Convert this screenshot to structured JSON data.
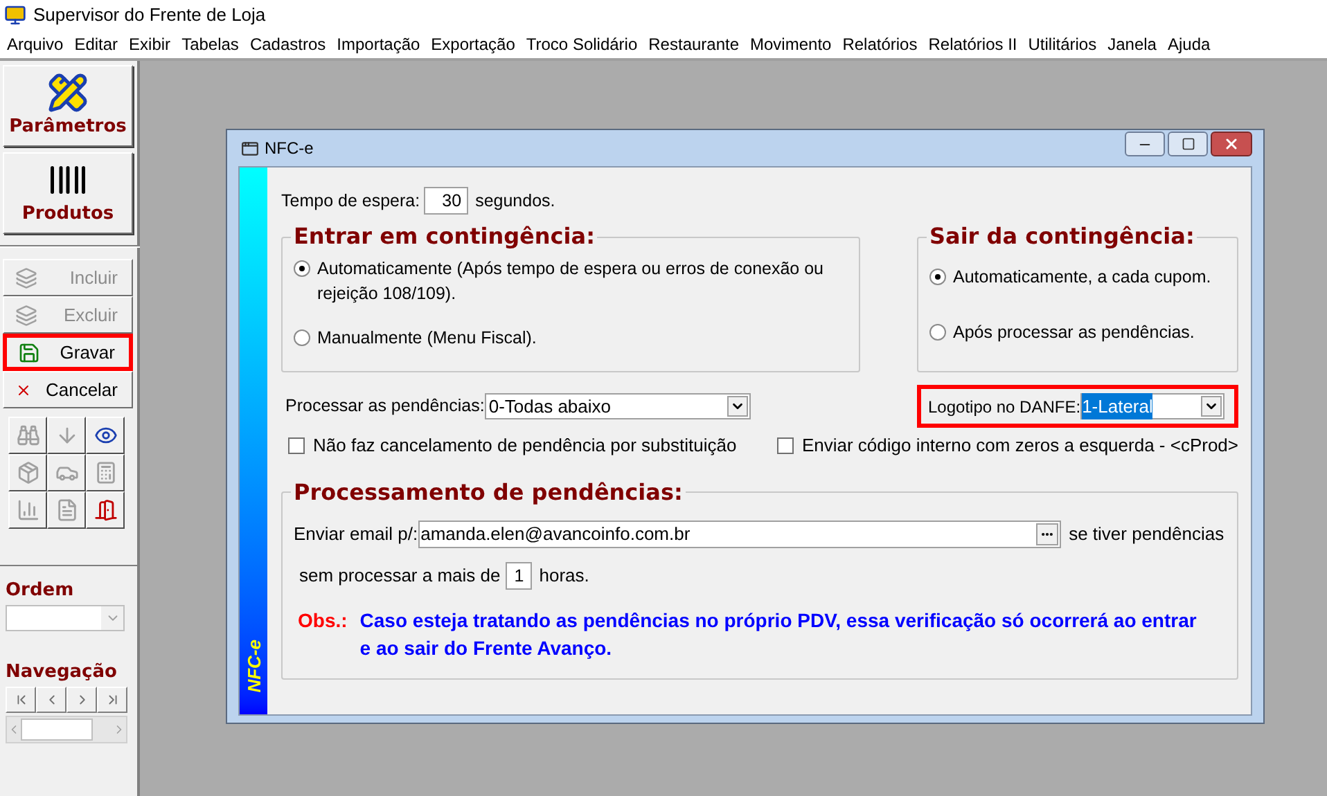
{
  "app": {
    "title": "Supervisor do Frente de Loja"
  },
  "menu": [
    "Arquivo",
    "Editar",
    "Exibir",
    "Tabelas",
    "Cadastros",
    "Importação",
    "Exportação",
    "Troco Solidário",
    "Restaurante",
    "Movimento",
    "Relatórios",
    "Relatórios II",
    "Utilitários",
    "Janela",
    "Ajuda"
  ],
  "toolbar": {
    "big_buttons": [
      {
        "label": "Parâmetros",
        "kind": "ruler"
      },
      {
        "label": "Produtos",
        "kind": "barcode"
      }
    ],
    "actions": [
      {
        "label": "Incluir",
        "kind": "add",
        "disabled": true,
        "highlighted": false
      },
      {
        "label": "Excluir",
        "kind": "remove",
        "disabled": true,
        "highlighted": false
      },
      {
        "label": "Gravar",
        "kind": "save",
        "disabled": false,
        "highlighted": true
      },
      {
        "label": "Cancelar",
        "kind": "cancel",
        "disabled": false,
        "highlighted": false
      }
    ],
    "tools": [
      {
        "kind": "binoculars",
        "disabled": true
      },
      {
        "kind": "arrows",
        "disabled": true
      },
      {
        "kind": "eye",
        "disabled": false
      },
      {
        "kind": "box",
        "disabled": true
      },
      {
        "kind": "car",
        "disabled": true
      },
      {
        "kind": "calculator",
        "disabled": true
      },
      {
        "kind": "chart",
        "disabled": true
      },
      {
        "kind": "document",
        "disabled": true
      },
      {
        "kind": "exit",
        "disabled": false
      }
    ],
    "order": {
      "label": "Ordem"
    },
    "navigation": {
      "label": "Navegação"
    }
  },
  "window": {
    "title": "NFC-e",
    "side_label": "NFC-e",
    "wait": {
      "label": "Tempo de espera:",
      "value": "30",
      "unit": "segundos."
    },
    "enter": {
      "title": "Entrar em contingência:",
      "options": [
        {
          "label": "Automaticamente (Após tempo de espera ou erros de conexão ou rejeição 108/109).",
          "selected": true
        },
        {
          "label": "Manualmente (Menu Fiscal).",
          "selected": false
        }
      ]
    },
    "exit": {
      "title": "Sair da contingência:",
      "options": [
        {
          "label": "Automaticamente, a cada cupom.",
          "selected": true
        },
        {
          "label": "Após processar as pendências.",
          "selected": false
        }
      ]
    },
    "process": {
      "label": "Processar as pendências:",
      "value": "0-Todas abaixo"
    },
    "logo": {
      "label": "Logotipo no DANFE:",
      "value": "1-Lateral",
      "text_selected": true,
      "highlighted": true
    },
    "checkboxes": [
      {
        "label": "Não faz cancelamento de pendência por substituição",
        "checked": false
      },
      {
        "label": "Enviar código interno com zeros a esquerda - <cProd>",
        "checked": false
      }
    ],
    "pending": {
      "title": "Processamento de pendências:",
      "email_label": "Enviar email p/:",
      "email": "amanda.elen@avancoinfo.com.br",
      "email_suffix": "se tiver pendências",
      "hours_label": "sem processar a mais de",
      "hours": "1",
      "hours_unit": "horas.",
      "note_label": "Obs.:",
      "note": "Caso esteja tratando as pendências no próprio PDV, essa verificação só ocorrerá ao entrar e ao sair do Frente Avanço."
    }
  }
}
